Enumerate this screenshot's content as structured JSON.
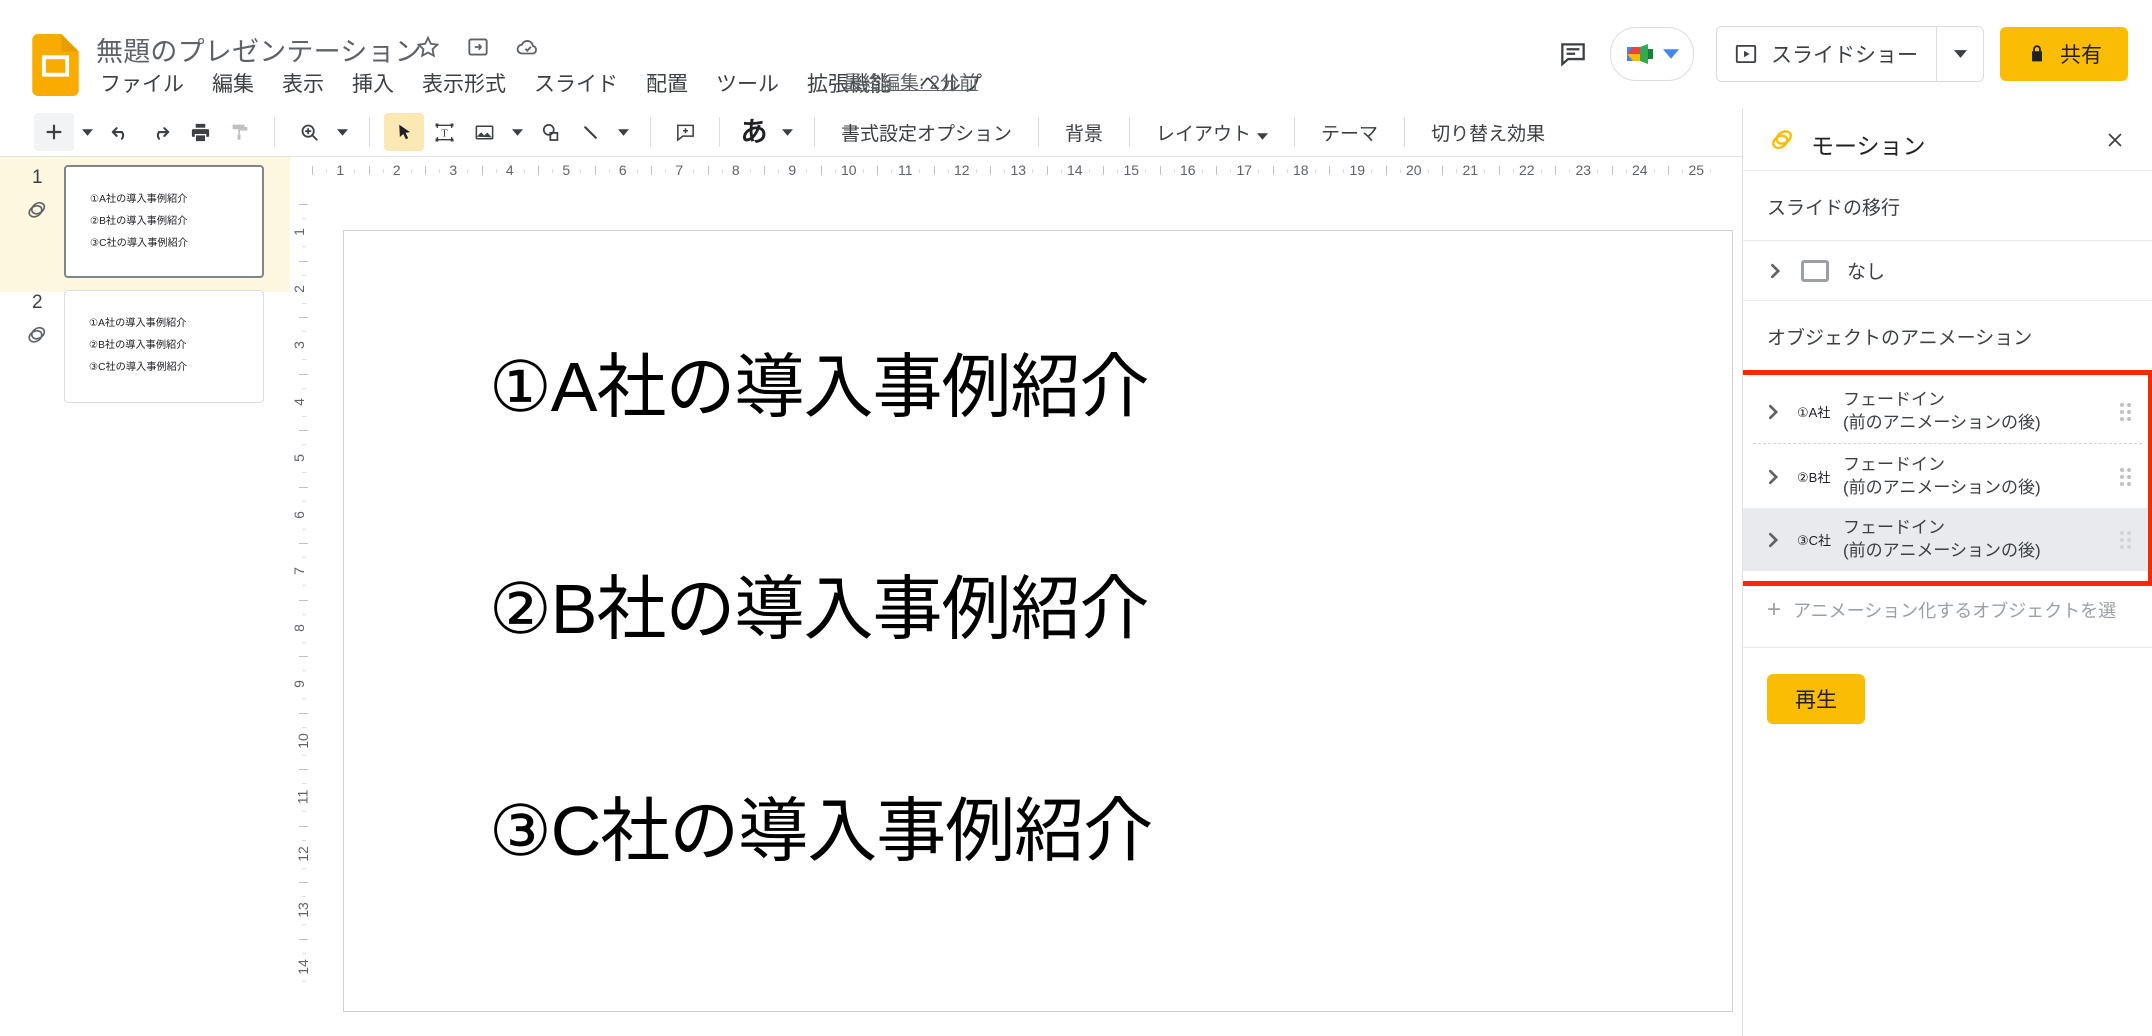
{
  "app": {
    "doc_title": "無題のプレゼンテーション",
    "last_edit": "最終編集: 2分前"
  },
  "title_icons": [
    {
      "name": "star-icon",
      "glyph": "☆"
    },
    {
      "name": "move-to-folder-icon",
      "glyph": "▣"
    },
    {
      "name": "cloud-saved-icon",
      "glyph": "☁"
    }
  ],
  "menus": [
    {
      "label": "ファイル"
    },
    {
      "label": "編集"
    },
    {
      "label": "表示"
    },
    {
      "label": "挿入"
    },
    {
      "label": "表示形式"
    },
    {
      "label": "スライド"
    },
    {
      "label": "配置"
    },
    {
      "label": "ツール"
    },
    {
      "label": "拡張機能"
    },
    {
      "label": "ヘルプ"
    }
  ],
  "top_right": {
    "comment_icon": "comment-icon",
    "meet_icon": "google-meet-icon",
    "slideshow_label": "スライドショー",
    "share_label": "共有",
    "share_lock_icon": "lock-icon",
    "share_color": "#fbbc04"
  },
  "toolbar": {
    "buttons": [
      {
        "name": "new-slide-button",
        "icon": "plus"
      },
      {
        "name": "new-slide-caret",
        "icon": "caret"
      },
      {
        "name": "undo-button",
        "icon": "undo"
      },
      {
        "name": "redo-button",
        "icon": "redo"
      },
      {
        "name": "print-button",
        "icon": "print"
      },
      {
        "name": "paint-format-button",
        "icon": "paint-format"
      },
      {
        "name": "zoom-button",
        "icon": "zoom"
      },
      {
        "name": "zoom-caret",
        "icon": "caret"
      },
      {
        "name": "select-tool-button",
        "icon": "cursor"
      },
      {
        "name": "text-box-button",
        "icon": "textbox"
      },
      {
        "name": "image-button",
        "icon": "image"
      },
      {
        "name": "image-caret",
        "icon": "caret"
      },
      {
        "name": "shape-button",
        "icon": "shape"
      },
      {
        "name": "line-button",
        "icon": "line"
      },
      {
        "name": "line-caret",
        "icon": "caret"
      },
      {
        "name": "comment-add-button",
        "icon": "comment-add"
      },
      {
        "name": "text-language-button",
        "icon": "japanese-a"
      },
      {
        "name": "text-language-caret",
        "icon": "caret"
      }
    ],
    "text_items": [
      {
        "name": "format-options-button",
        "label": "書式設定オプション"
      },
      {
        "name": "background-button",
        "label": "背景"
      },
      {
        "name": "layout-button",
        "label": "レイアウト",
        "caret": true
      },
      {
        "name": "theme-button",
        "label": "テーマ"
      },
      {
        "name": "transition-button",
        "label": "切り替え効果"
      }
    ],
    "collapse_icon": "chevron-up-icon"
  },
  "filmstrip": {
    "slides": [
      {
        "number": "1",
        "selected": true,
        "lines": [
          "①A社の導入事例紹介",
          "②B社の導入事例紹介",
          "③C社の導入事例紹介"
        ]
      },
      {
        "number": "2",
        "selected": false,
        "lines": [
          "①A社の導入事例紹介",
          "②B社の導入事例紹介",
          "③C社の導入事例紹介"
        ]
      }
    ]
  },
  "rulers": {
    "horizontal_labels": [
      "1",
      "2",
      "3",
      "4",
      "5",
      "6",
      "7",
      "8",
      "9",
      "10",
      "11",
      "12",
      "13",
      "14",
      "15",
      "16",
      "17",
      "18",
      "19",
      "20",
      "21",
      "22",
      "23",
      "24",
      "25"
    ],
    "vertical_labels": [
      "1",
      "2",
      "3",
      "4",
      "5",
      "6",
      "7",
      "8",
      "9",
      "10",
      "11",
      "12",
      "13",
      "14"
    ]
  },
  "slide": {
    "lines": [
      "①A社の導入事例紹介",
      "②B社の導入事例紹介",
      "③C社の導入事例紹介"
    ]
  },
  "panel": {
    "title": "モーション",
    "motion_icon": "motion-icon",
    "close_icon": "close-icon",
    "transition_section_label": "スライドの移行",
    "transition_value": "なし",
    "object_section_label": "オブジェクトのアニメーション",
    "animations": [
      {
        "object": "①A社",
        "effect": "フェードイン",
        "timing": "(前のアニメーションの後)",
        "selected": false
      },
      {
        "object": "②B社",
        "effect": "フェードイン",
        "timing": "(前のアニメーションの後)",
        "selected": false
      },
      {
        "object": "③C社",
        "effect": "フェードイン",
        "timing": "(前のアニメーションの後)",
        "selected": true
      }
    ],
    "add_object_label": "アニメーション化するオブジェクトを選",
    "play_label": "再生",
    "highlight_color": "#f42a00"
  }
}
